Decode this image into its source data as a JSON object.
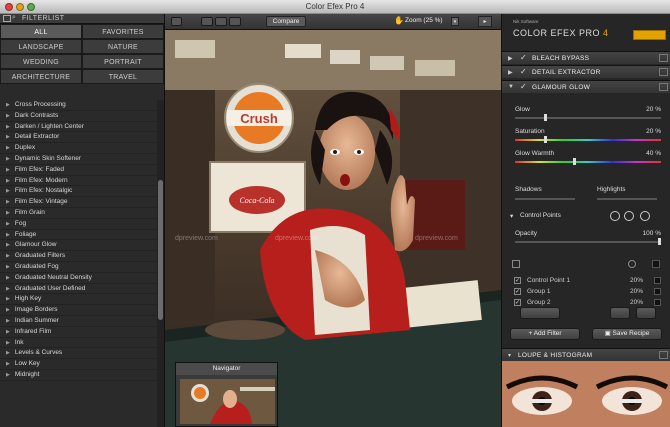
{
  "window": {
    "title": "Color Efex Pro 4"
  },
  "left_panel": {
    "title": "FILTERLIST",
    "categories": [
      "ALL",
      "FAVORITES",
      "LANDSCAPE",
      "NATURE",
      "WEDDING",
      "PORTRAIT",
      "ARCHITECTURE",
      "TRAVEL"
    ],
    "filters": [
      "Cross Processing",
      "Dark Contrasts",
      "Darken / Lighten Center",
      "Detail Extractor",
      "Duplex",
      "Dynamic Skin Softener",
      "Film Efex: Faded",
      "Film Efex: Modern",
      "Film Efex: Nostalgic",
      "Film Efex: Vintage",
      "Film Grain",
      "Fog",
      "Foliage",
      "Glamour Glow",
      "Graduated Filters",
      "Graduated Fog",
      "Graduated Neutral Density",
      "Graduated User Defined",
      "High Key",
      "Image Borders",
      "Indian Summer",
      "Infrared Film",
      "Ink",
      "Levels & Curves",
      "Low Key",
      "Midnight"
    ]
  },
  "toolbar": {
    "compare_label": "Compare",
    "zoom_label": "Zoom (25 %)"
  },
  "canvas": {
    "watermark": "dpreview.com"
  },
  "navigator": {
    "title": "Navigator"
  },
  "right_panel": {
    "brand_small": "Nik Software",
    "brand": "COLOR EFEX PRO",
    "brand_version": "4",
    "sections": [
      "BLEACH BYPASS",
      "DETAIL EXTRACTOR",
      "GLAMOUR GLOW"
    ],
    "sliders": [
      {
        "label": "Glow",
        "value": "20 %",
        "level": 0.2
      },
      {
        "label": "Saturation",
        "value": "20 %",
        "level": 0.2
      },
      {
        "label": "Glow Warmth",
        "value": "40 %",
        "level": 0.4
      }
    ],
    "shadows_label": "Shadows",
    "highlights_label": "Highlights",
    "control_points_label": "Control Points",
    "opacity": {
      "label": "Opacity",
      "value": "100 %",
      "level": 1.0
    },
    "control_point_rows": [
      {
        "name": "Control Point 1",
        "value": "20%"
      },
      {
        "name": "Group 1",
        "value": "20%"
      },
      {
        "name": "Group 2",
        "value": "20%"
      }
    ],
    "add_filter_label": "+ Add Filter",
    "save_recipe_label": "Save Recipe",
    "loupe_label": "LOUPE & HISTOGRAM"
  }
}
